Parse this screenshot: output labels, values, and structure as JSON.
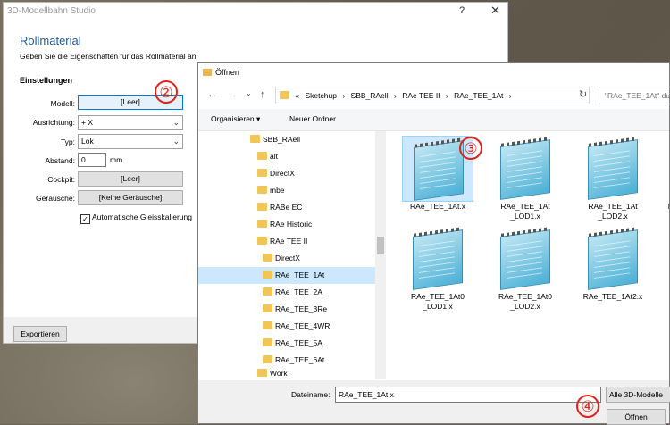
{
  "main_dialog": {
    "title": "3D-Modellbahn Studio",
    "help_glyph": "?",
    "close_glyph": "✕",
    "heading": "Rollmaterial",
    "subtitle": "Geben Sie die Eigenschaften für das Rollmaterial an.",
    "section": "Einstellungen",
    "labels": {
      "modell": "Modell:",
      "ausrichtung": "Ausrichtung:",
      "typ": "Typ:",
      "abstand": "Abstand:",
      "cockpit": "Cockpit:",
      "geraeusche": "Geräusche:"
    },
    "modell_value": "[Leer]",
    "ausrichtung_value": "+ X",
    "typ_value": "Lok",
    "abstand_value": "0",
    "abstand_unit": "mm",
    "cockpit_value": "[Leer]",
    "geraeusche_value": "[Keine Geräusche]",
    "auto_scale_label": "Automatische Gleisskalierung",
    "auto_scale_checked": true,
    "export_label": "Exportieren"
  },
  "annotations": {
    "step2": "②",
    "step3": "③",
    "step4": "④",
    "color": "#e0231c"
  },
  "open_dialog": {
    "title": "Öffnen",
    "breadcrumb": [
      "«",
      "Sketchup",
      "›",
      "SBB_RAell",
      "›",
      "RAe TEE II",
      "›",
      "RAe_TEE_1At",
      "›"
    ],
    "search_placeholder": "\"RAe_TEE_1At\" du",
    "organize_label": "Organisieren ▾",
    "new_folder_label": "Neuer Ordner",
    "tree": [
      "SBB_RAell",
      "alt",
      "DirectX",
      "mbe",
      "RABe EC",
      "RAe Historic",
      "RAe TEE II",
      "DirectX",
      "RAe_TEE_1At",
      "RAe_TEE_2A",
      "RAe_TEE_3Re",
      "RAe_TEE_4WR",
      "RAe_TEE_5A",
      "RAe_TEE_6At",
      "Work"
    ],
    "files": [
      {
        "name": "RAe_TEE_1At.x"
      },
      {
        "name": "RAe_TEE_1At_LOD1.x"
      },
      {
        "name": "RAe_TEE_1At_LOD2.x"
      },
      {
        "name": "RAe_TEE_1At0.x"
      },
      {
        "name": "RAe_TEE_1At0_LOD1.x"
      },
      {
        "name": "RAe_TEE_1At0_LOD2.x"
      },
      {
        "name": "RAe_TEE_1At2.x"
      }
    ],
    "filename_label": "Dateiname:",
    "filename_value": "RAe_TEE_1At.x",
    "filter_value": "Alle 3D-Modelle",
    "open_label": "Öffnen"
  }
}
